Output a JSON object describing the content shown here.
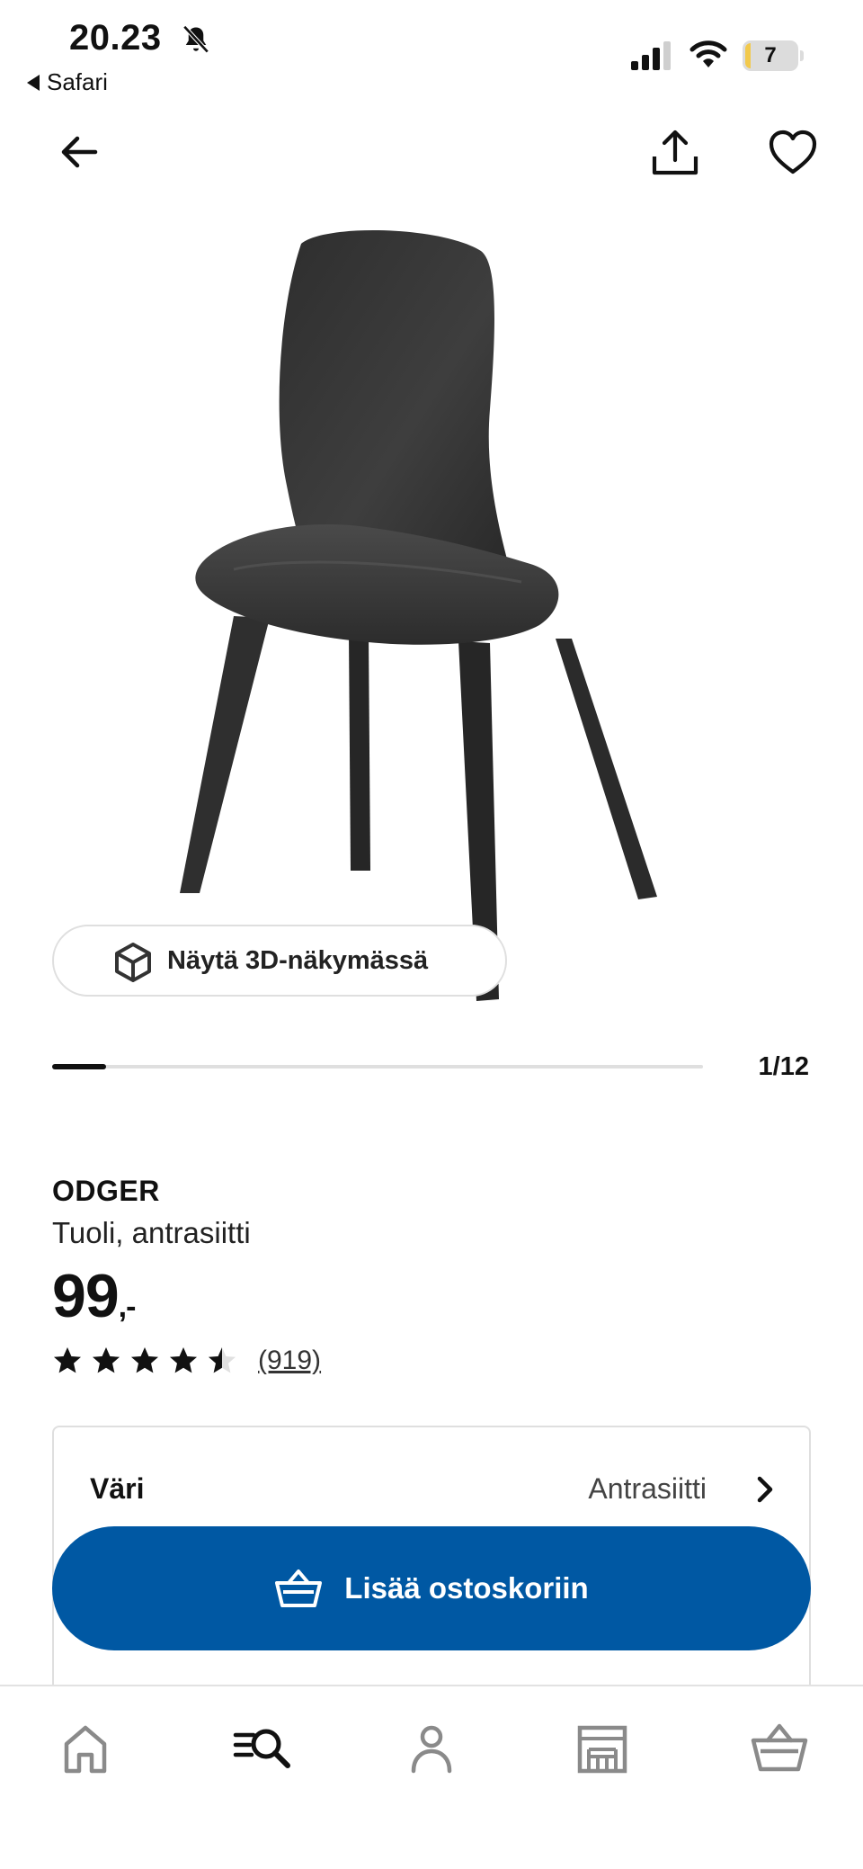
{
  "status_bar": {
    "time": "20.23",
    "back_app": "Safari",
    "battery": "7"
  },
  "icons": {
    "back": "arrow-left-icon",
    "share": "share-icon",
    "favorite": "heart-icon",
    "view_3d": "cube-icon",
    "chevron": "chevron-right-icon",
    "basket": "basket-icon",
    "tabs": [
      "home-icon",
      "search-icon",
      "profile-icon",
      "store-icon",
      "basket-icon"
    ]
  },
  "gallery": {
    "view_3d_label": "Näytä 3D-näkymässä",
    "pager": "1/12",
    "progress_fraction": 0.0833
  },
  "product": {
    "name": "ODGER",
    "description": "Tuoli, antrasiitti",
    "price": "99",
    "price_suffix": ",-",
    "rating": 4.5,
    "rating_max": 5,
    "review_count": "(919)"
  },
  "options": {
    "color_label": "Väri",
    "color_value": "Antrasiitti"
  },
  "actions": {
    "add_to_cart": "Lisää ostoskoriin"
  },
  "colors": {
    "brand_blue": "#0058a3",
    "chair": "#3a3a3a"
  }
}
